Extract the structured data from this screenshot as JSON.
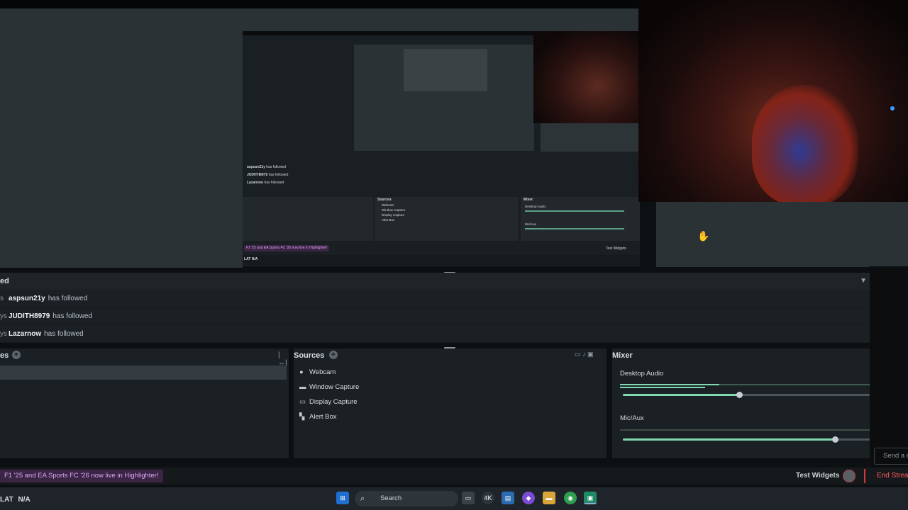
{
  "follows": {
    "header": "ed",
    "rows": [
      {
        "edge": "s",
        "user": "aspsun21y",
        "action": "has followed"
      },
      {
        "edge": "ys",
        "user": "JUDITH8979",
        "action": "has followed"
      },
      {
        "edge": "ys",
        "user": "Lazarnow",
        "action": "has followed"
      }
    ]
  },
  "scenes": {
    "title": "es"
  },
  "sources": {
    "title": "Sources",
    "items": [
      {
        "label": "Webcam",
        "icon": "webcam-icon"
      },
      {
        "label": "Window Capture",
        "icon": "window-icon"
      },
      {
        "label": "Display Capture",
        "icon": "monitor-icon"
      },
      {
        "label": "Alert Box",
        "icon": "alert-box-icon"
      }
    ]
  },
  "mixer": {
    "title": "Mixer",
    "channels": [
      {
        "label": "Desktop Audio",
        "volume": 0.47
      },
      {
        "label": "Mic/Aux",
        "volume": 0.86
      }
    ]
  },
  "footer": {
    "ticker": "F1 '25 and EA Sports FC '26 now live in Highlighter!",
    "test_widgets": "Test Widgets",
    "end_stream": "End Stream",
    "send_placeholder": "Send a m"
  },
  "taskbar": {
    "lat": "LAT",
    "lat_value": "N/A",
    "search": "Search",
    "icons": [
      "windows-icon",
      "task-view-icon",
      "4k-icon",
      "file-explorer-icon",
      "copilot-icon",
      "folder-icon",
      "chrome-icon",
      "streamlabs-icon"
    ]
  },
  "nested_preview": {
    "follows": [
      {
        "user": "aspsun21y",
        "action": "has followed"
      },
      {
        "user": "JUDITH8979",
        "action": "has followed"
      },
      {
        "user": "Lazarnow",
        "action": "has followed"
      }
    ],
    "sources": [
      "Webcam",
      "Window Capture",
      "Display Capture",
      "Alert Box"
    ],
    "mixer_labels": [
      "Desktop Audio",
      "Mic/Aux"
    ],
    "sources_title": "Sources",
    "mixer_title": "Mixer",
    "ticker": "F1 '25 and EA Sports FC '26 now live in Highlighter!",
    "test_widgets": "Test Widgets",
    "lat": "LAT  N/A"
  },
  "colors": {
    "accent_purple": "#3b2545",
    "end_stream_red": "#ff5a5a",
    "meter_green": "#7fd8b0"
  }
}
